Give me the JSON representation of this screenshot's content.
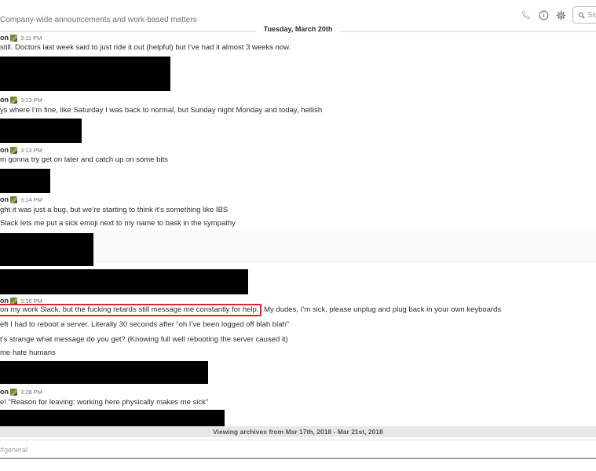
{
  "header": {
    "channel_description": "Company-wide announcements and work-based matters",
    "icons": [
      "phone-icon",
      "info-icon",
      "gear-icon"
    ],
    "search_placeholder": "Se"
  },
  "date_divider": "Tuesday, March 20th",
  "messages": [
    {
      "author": "on",
      "time": "3:11 PM",
      "lines": [
        "still. Doctors last week said to just ride it out (helpful) but I’ve had it almost 3 weeks now."
      ]
    },
    {
      "author": "on",
      "time": "3:13 PM",
      "lines": [
        "ys where I’m fine, like Saturday I was back to normal, but Sunday night Monday and today, hellish"
      ]
    },
    {
      "author": "on",
      "time": "3:13 PM",
      "lines": [
        "m gonna try get on later and catch up on some bits"
      ]
    },
    {
      "author": "on",
      "time": "3:14 PM",
      "lines": [
        "ght it was just a bug, but we’re starting to think it’s something like IBS",
        " Slack lets me put a sick emoji next to my name to bask in the sympathy"
      ]
    },
    {
      "author": "on",
      "time": "3:16 PM",
      "highlight": "on my work Slack, but the fucking retards still message me constantly for help.",
      "rest": " My dudes, I’m sick, please unplug and plug back in your own keyboards",
      "lines": [
        "eft I had to reboot a server. Literally 30 seconds after “oh I’ve been logged off blah blah”",
        "t’s strange what message do you get? (Knowing full well rebooting the server caused it)",
        " me hate humans"
      ]
    },
    {
      "author": "on",
      "time": "3:28 PM",
      "lines": [
        "e! “Reason for leaving: working here physically makes me sick”"
      ]
    }
  ],
  "archive_bar": "Viewing archives from Mar 17th, 2018 - Mar 21st, 2018",
  "composer": {
    "placeholder": "#general"
  }
}
